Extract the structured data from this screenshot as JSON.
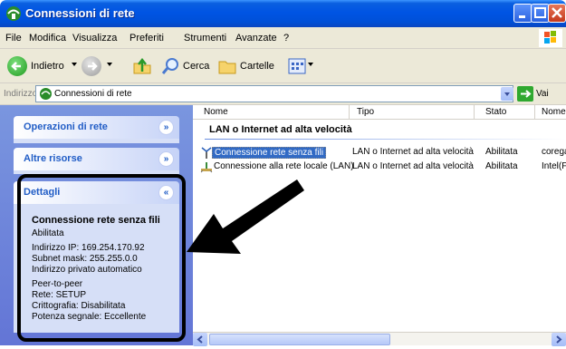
{
  "window": {
    "title": "Connessioni di rete"
  },
  "menu": {
    "items": [
      "File",
      "Modifica",
      "Visualizza",
      "Preferiti",
      "Strumenti",
      "Avanzate",
      "?"
    ]
  },
  "toolbar": {
    "back_label": "Indietro",
    "search_label": "Cerca",
    "folders_label": "Cartelle"
  },
  "address": {
    "label": "Indirizzo",
    "value": "Connessioni di rete",
    "go_label": "Vai"
  },
  "left_panel": {
    "network_tasks": "Operazioni di rete",
    "other_places": "Altre risorse",
    "details": "Dettagli",
    "details_title": "Connessione rete senza fili",
    "details_status": "Abilitata",
    "ip": "Indirizzo IP: 169.254.170.92",
    "subnet": "Subnet mask: 255.255.0.0",
    "private": "Indirizzo privato automatico",
    "mode": "Peer-to-peer",
    "network": "Rete: SETUP",
    "encryption": "Crittografia: Disabilitata",
    "signal": "Potenza segnale: Eccellente"
  },
  "columns": [
    "Nome",
    "Tipo",
    "Stato",
    "Nome"
  ],
  "group": {
    "title": "LAN o Internet ad alta velocità"
  },
  "rows": [
    {
      "name": "Connessione rete senza fili",
      "type": "LAN o Internet ad alta velocità",
      "status": "Abilitata",
      "device": "corega"
    },
    {
      "name": "Connessione alla rete locale (LAN)",
      "type": "LAN o Internet ad alta velocità",
      "status": "Abilitata",
      "device": "Intel(F"
    }
  ],
  "colors": {
    "title_bar": "#0054e3",
    "left_pane": "#7a96df",
    "panel_title": "#215dc6",
    "selection": "#316ac5"
  }
}
